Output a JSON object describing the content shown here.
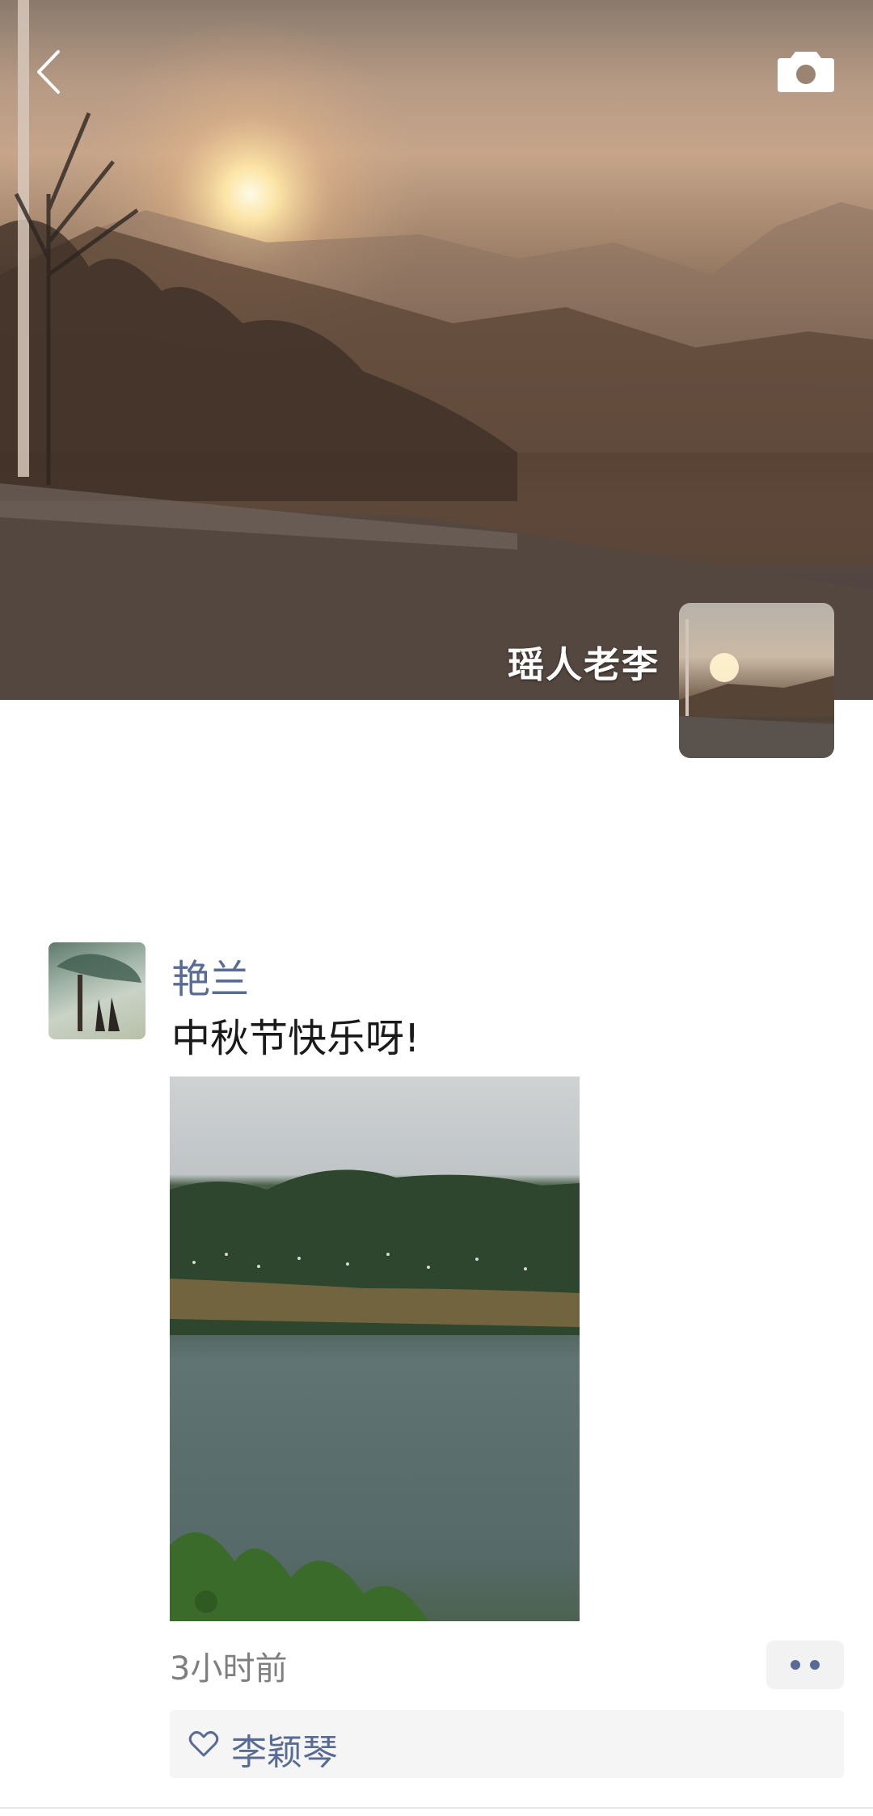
{
  "cover": {
    "owner_name": "瑶人老李"
  },
  "post": {
    "author": "艳兰",
    "text": "中秋节快乐呀!",
    "time": "3小时前",
    "likes": [
      "李颖琴"
    ]
  },
  "icons": {
    "back": "back-chevron-icon",
    "camera": "camera-icon",
    "more": "more-dots-icon",
    "like": "heart-icon"
  },
  "colors": {
    "link_blue": "#576b95",
    "text_dark": "#1a1a1a",
    "time_gray": "#7f7f7f",
    "likes_bg": "#f5f5f5"
  }
}
